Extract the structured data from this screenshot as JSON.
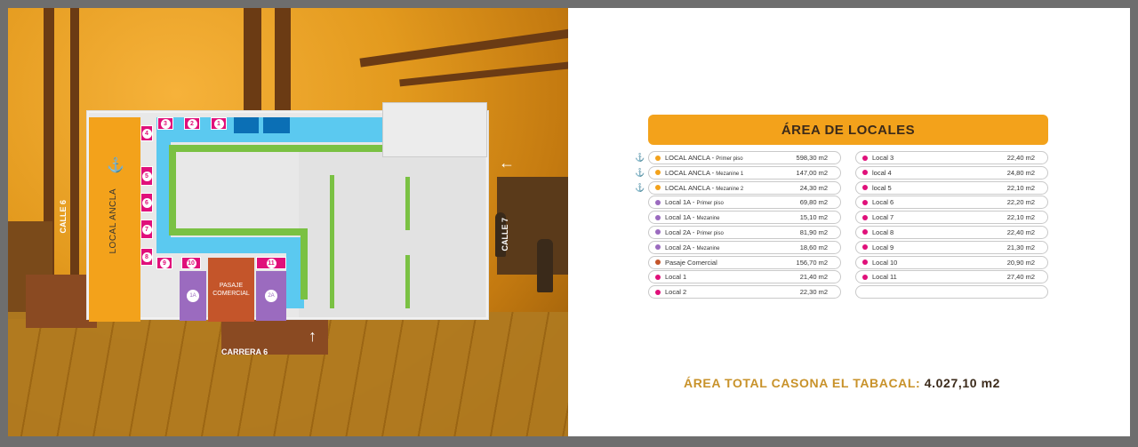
{
  "colors": {
    "anchor": "#f3a21b",
    "local": "#e0107a",
    "mezz": "#9b6bbf",
    "pasaje": "#c4552a"
  },
  "plan": {
    "local_ancla": "LOCAL ANCLA",
    "pasaje": "PASAJE COMERCIAL",
    "unit_labels": [
      "3",
      "2",
      "1",
      "4",
      "5",
      "6",
      "7",
      "8",
      "9",
      "10",
      "11",
      "1A",
      "2A"
    ],
    "streets": {
      "calle6": "CALLE 6",
      "calle7": "CALLE 7",
      "carrera6": "CARRERA 6"
    }
  },
  "panel": {
    "title": "ÁREA DE LOCALES",
    "total_label": "ÁREA TOTAL CASONA EL TABACAL:",
    "total_value": "4.027,10 m2"
  },
  "left_rows": [
    {
      "name": "LOCAL ANCLA - ",
      "sub": "Primer piso",
      "value": "598,30 m2",
      "color": "#f3a21b",
      "anchor": true
    },
    {
      "name": "LOCAL ANCLA - ",
      "sub": "Mezanine 1",
      "value": "147,00 m2",
      "color": "#f3a21b",
      "anchor": true
    },
    {
      "name": "LOCAL ANCLA - ",
      "sub": "Mezanine 2",
      "value": "24,30 m2",
      "color": "#f3a21b",
      "anchor": true
    },
    {
      "name": "Local 1A - ",
      "sub": "Primer piso",
      "value": "69,80 m2",
      "color": "#9b6bbf"
    },
    {
      "name": "Local 1A - ",
      "sub": "Mezanine",
      "value": "15,10 m2",
      "color": "#9b6bbf"
    },
    {
      "name": "Local 2A - ",
      "sub": "Primer piso",
      "value": "81,90 m2",
      "color": "#9b6bbf"
    },
    {
      "name": "Local 2A - ",
      "sub": "Mezanine",
      "value": "18,60 m2",
      "color": "#9b6bbf"
    },
    {
      "name": "Pasaje Comercial",
      "sub": "",
      "value": "156,70 m2",
      "color": "#c4552a"
    },
    {
      "name": "Local 1",
      "sub": "",
      "value": "21,40 m2",
      "color": "#e0107a"
    },
    {
      "name": "Local 2",
      "sub": "",
      "value": "22,30 m2",
      "color": "#e0107a"
    }
  ],
  "right_rows": [
    {
      "name": "Local 3",
      "value": "22,40 m2"
    },
    {
      "name": "local 4",
      "value": "24,80 m2"
    },
    {
      "name": "local 5",
      "value": "22,10 m2"
    },
    {
      "name": "Local 6",
      "value": "22,20 m2"
    },
    {
      "name": "Local 7",
      "value": "22,10 m2"
    },
    {
      "name": "Local 8",
      "value": "22,40 m2"
    },
    {
      "name": "Local 9",
      "value": "21,30 m2"
    },
    {
      "name": "Local 10",
      "value": "20,90 m2"
    },
    {
      "name": "Local 11",
      "value": "27,40 m2"
    },
    {
      "name": "",
      "value": ""
    }
  ]
}
